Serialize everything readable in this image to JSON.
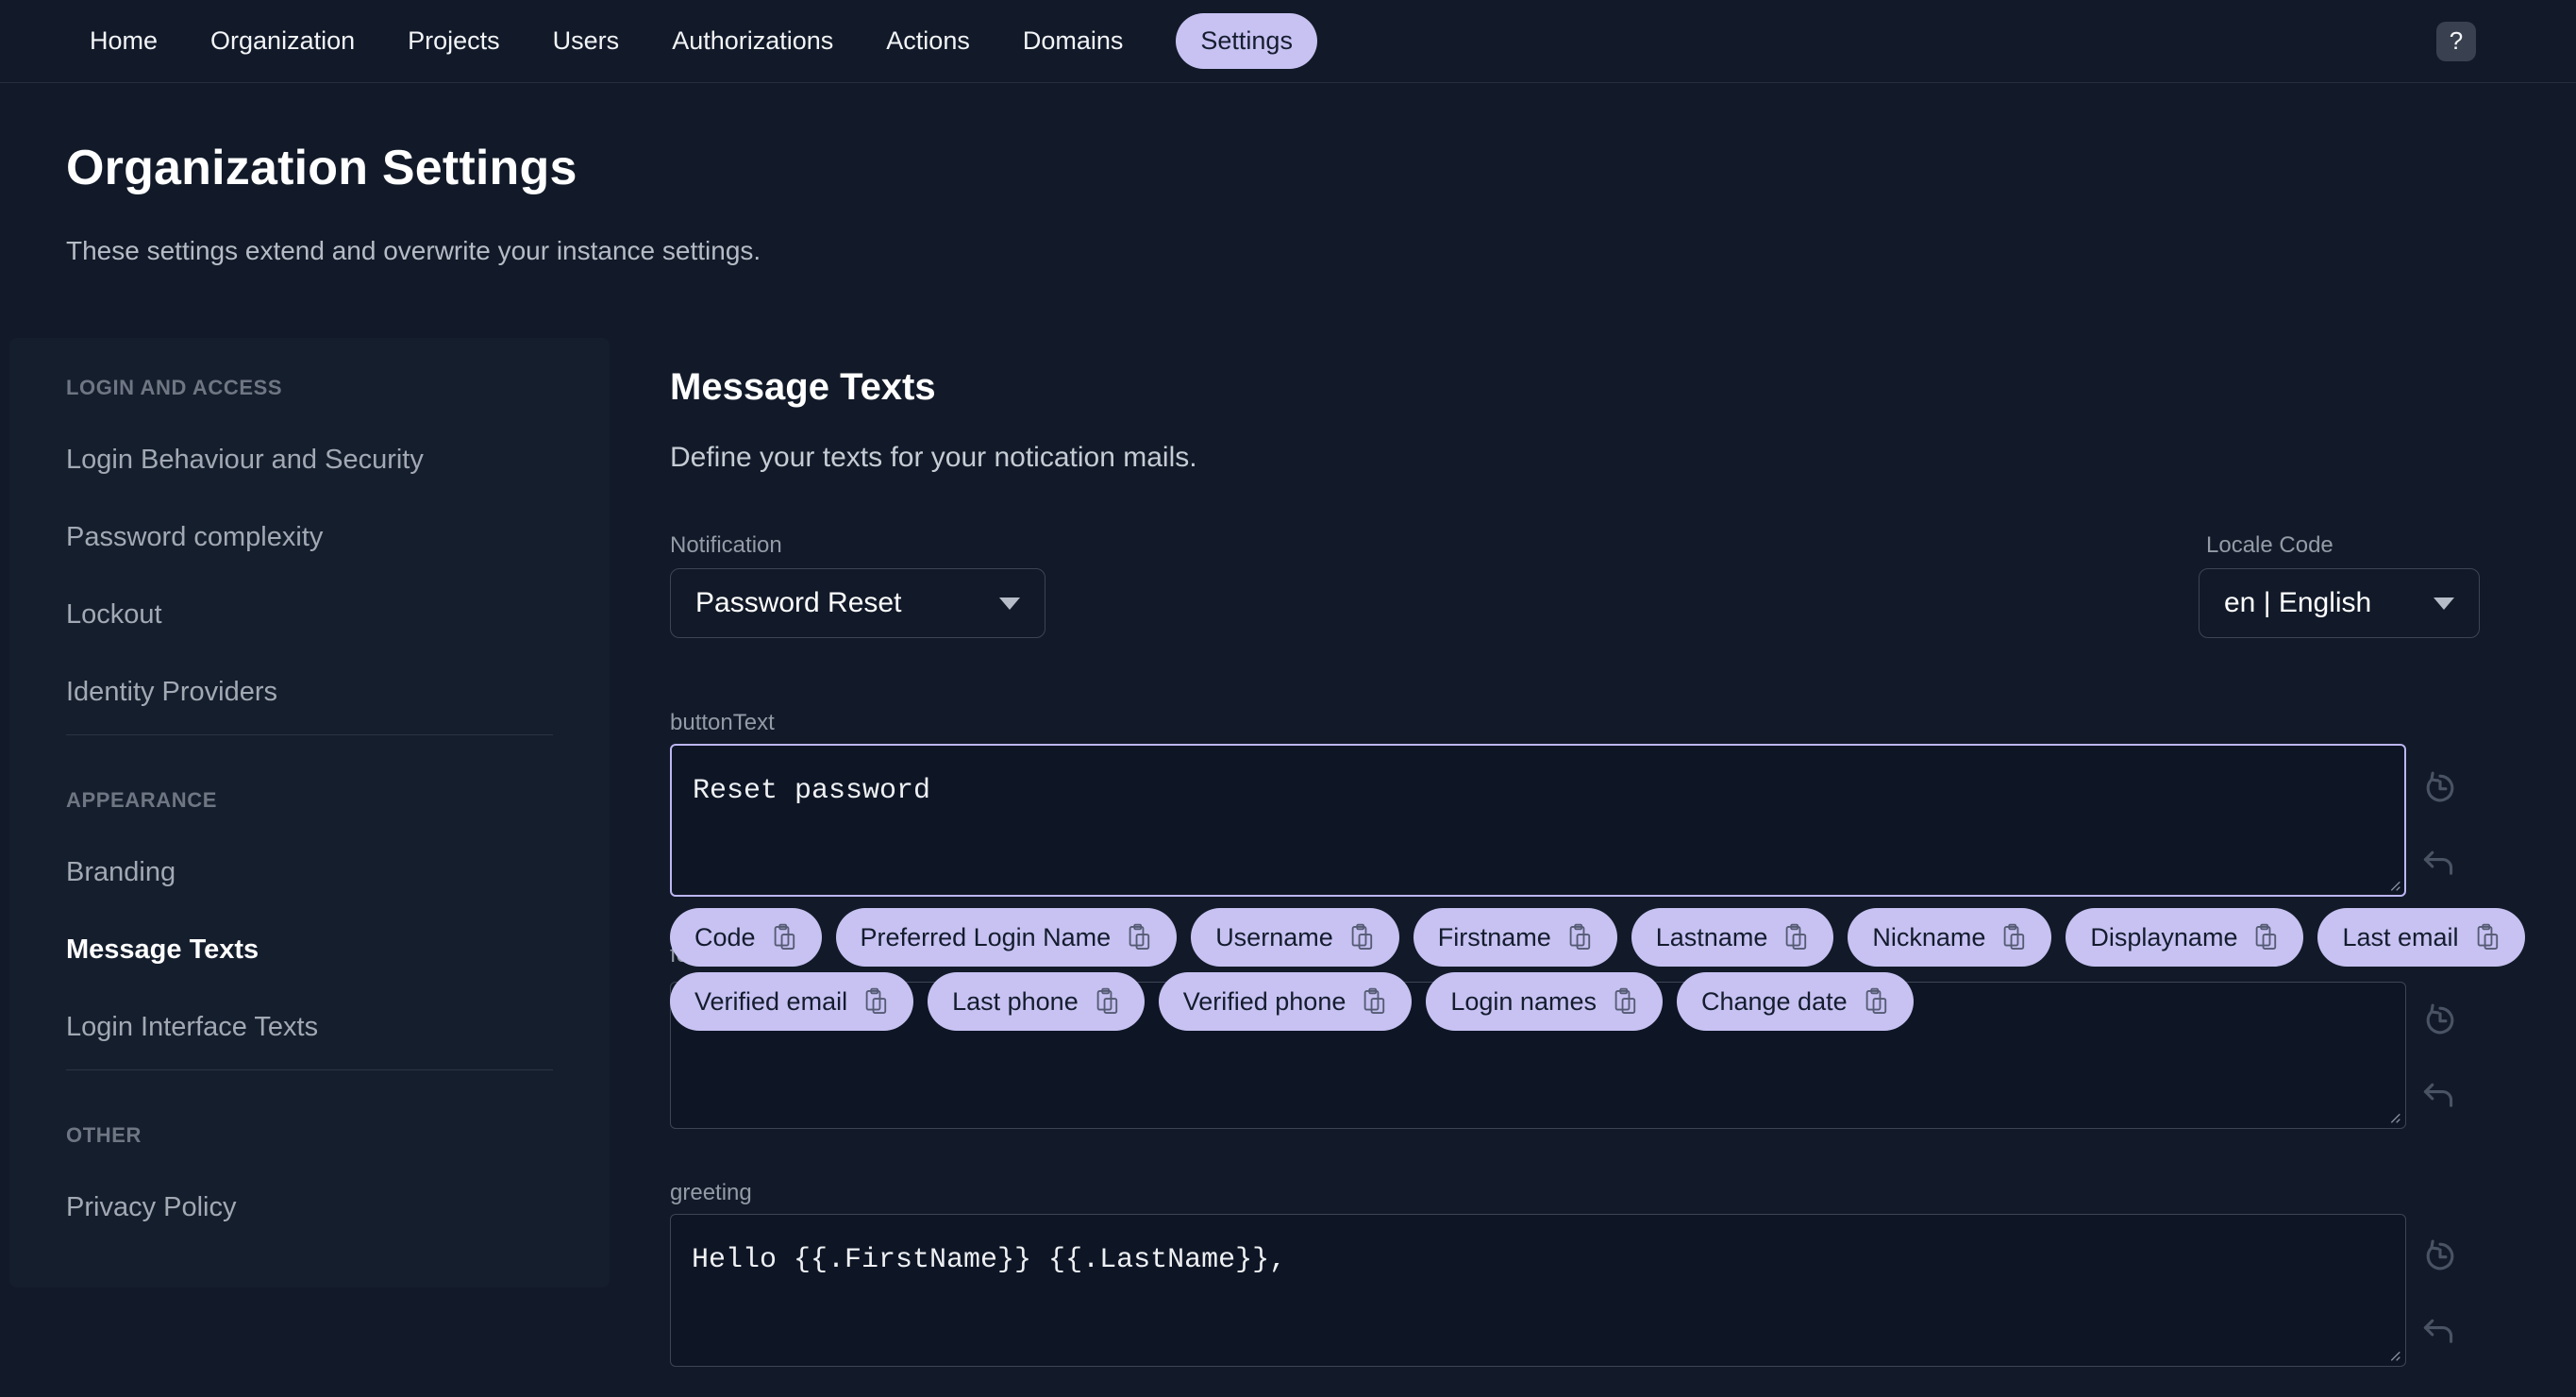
{
  "nav": {
    "items": [
      "Home",
      "Organization",
      "Projects",
      "Users",
      "Authorizations",
      "Actions",
      "Domains",
      "Settings"
    ],
    "active_item": "Settings",
    "help_label": "?"
  },
  "header": {
    "title": "Organization Settings",
    "subtitle": "These settings extend and overwrite your instance settings."
  },
  "sidebar": {
    "sections": [
      {
        "title": "LOGIN AND ACCESS",
        "items": [
          "Login Behaviour and Security",
          "Password complexity",
          "Lockout",
          "Identity Providers"
        ]
      },
      {
        "title": "APPEARANCE",
        "items": [
          "Branding",
          "Message Texts",
          "Login Interface Texts"
        ]
      },
      {
        "title": "OTHER",
        "items": [
          "Privacy Policy"
        ]
      }
    ],
    "active_item": "Message Texts"
  },
  "main": {
    "title": "Message Texts",
    "subtitle": "Define your texts for your notication mails.",
    "notification": {
      "label": "Notification",
      "value": "Password Reset"
    },
    "locale": {
      "label": "Locale Code",
      "value": "en | English"
    },
    "fields": {
      "buttonText": {
        "label": "buttonText",
        "value": "Reset password"
      },
      "footerText": {
        "label": "footerText",
        "value": ""
      },
      "greeting": {
        "label": "greeting",
        "value": "Hello {{.FirstName}} {{.LastName}},"
      }
    },
    "chips_row1": [
      "Code",
      "Preferred Login Name",
      "Username",
      "Firstname",
      "Lastname",
      "Nickname",
      "Displayname",
      "Last email"
    ],
    "chips_row2": [
      "Verified email",
      "Last phone",
      "Verified phone",
      "Login names",
      "Change date"
    ]
  },
  "icons": [
    "help-icon",
    "chevron-down-icon",
    "history-restore-icon",
    "undo-icon",
    "clipboard-icon",
    "resize-handle-icon"
  ],
  "colors": {
    "page_bg": "#121a29",
    "sidebar_bg": "#151e2d",
    "field_bg": "#0e1626",
    "accent_lavender": "#c7c2f2",
    "focus_border": "#bcb6f2",
    "border": "#3d4554",
    "chip_text": "#141c2e"
  }
}
